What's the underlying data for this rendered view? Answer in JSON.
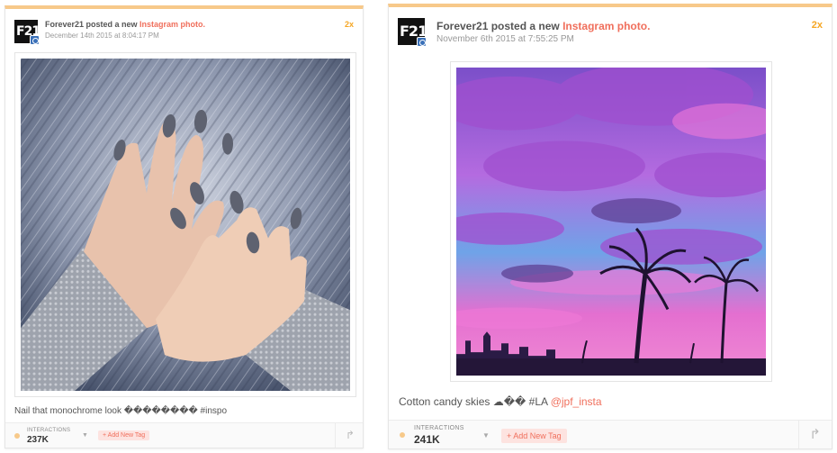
{
  "posts": [
    {
      "author": "Forever21",
      "action": " posted a new ",
      "link": "Instagram photo.",
      "timestamp": "December 14th 2015 at 8:04:17 PM",
      "multiplier": "2x",
      "logo_text": "F21",
      "photo_alt": "hands with grey nail polish on blue fur",
      "caption": "Nail that monochrome look �������� #inspo",
      "mention": "",
      "interactions_label": "INTERACTIONS",
      "interactions_value": "237K",
      "add_tag_label": "+ Add New Tag"
    },
    {
      "author": "Forever21",
      "action": " posted a new ",
      "link": "Instagram photo.",
      "timestamp": "November 6th 2015 at 7:55:25 PM",
      "multiplier": "2x",
      "logo_text": "F21",
      "photo_alt": "pink and purple sunset sky with palm trees over LA skyline",
      "caption": "Cotton candy skies ☁�� #LA ",
      "mention": "@jpf_insta",
      "interactions_label": "INTERACTIONS",
      "interactions_value": "241K",
      "add_tag_label": "+ Add New Tag"
    }
  ],
  "colors": {
    "accent": "#f06f5c",
    "top_border": "#f7c98a",
    "multiplier": "#f5a623",
    "tag_bg": "#fde3e0"
  },
  "icons": {
    "dropdown": "chevron-down-icon",
    "share": "share-icon",
    "platform": "instagram-icon"
  }
}
